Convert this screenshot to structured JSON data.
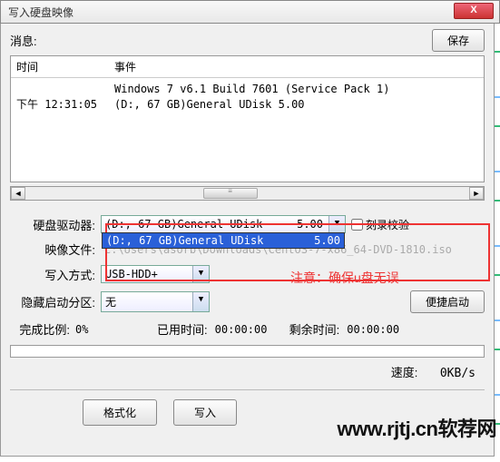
{
  "window": {
    "title": "写入硬盘映像",
    "close": "X"
  },
  "message": {
    "label": "消息:",
    "save_btn": "保存"
  },
  "log": {
    "header_time": "时间",
    "header_event": "事件",
    "line1": "Windows 7 v6.1 Build 7601 (Service Pack 1)",
    "line2_time": "下午 12:31:05",
    "line2_event": "(D:, 67 GB)General UDisk          5.00"
  },
  "form": {
    "drive_label": "硬盘驱动器:",
    "drive_value": "(D:, 67 GB)General UDisk",
    "drive_value_right": "5.00",
    "drive_option2": "(D:, 67 GB)General UDisk",
    "drive_option2_right": "5.00",
    "verify_label": "刻录校验",
    "image_label": "映像文件:",
    "image_path": "C:\\Users\\asorb\\Downloads\\CentOS-7-x86_64-DVD-1810.iso",
    "write_label": "写入方式:",
    "write_value": "USB-HDD+",
    "hidden_label": "隐藏启动分区:",
    "hidden_value": "无",
    "quick_boot_btn": "便捷启动"
  },
  "stats": {
    "done_label": "完成比例:",
    "done_value": "0%",
    "elapsed_label": "已用时间:",
    "elapsed_value": "00:00:00",
    "remain_label": "剩余时间:",
    "remain_value": "00:00:00",
    "speed_label": "速度:",
    "speed_value": "0KB/s"
  },
  "buttons": {
    "format": "格式化",
    "write": "写入"
  },
  "annotation": "注意：确保u盘无误",
  "watermark": "www.rjtj.cn软荐网"
}
